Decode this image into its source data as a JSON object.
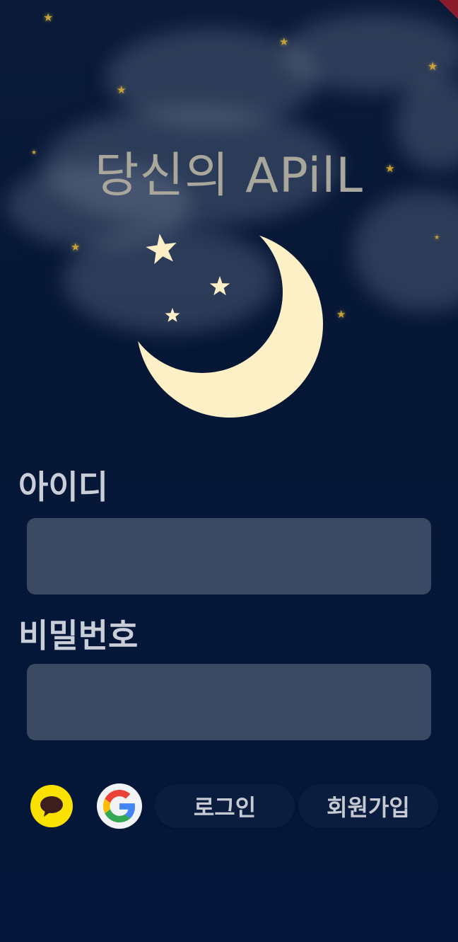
{
  "app": {
    "title": "당신의 APilL"
  },
  "form": {
    "id_label": "아이디",
    "id_value": "",
    "password_label": "비밀번호",
    "password_value": ""
  },
  "actions": {
    "kakao_icon": "kakao-talk-bubble-icon",
    "google_icon": "google-g-icon",
    "login_label": "로그인",
    "signup_label": "회원가입"
  },
  "colors": {
    "background": "#061736",
    "moon": "#fdf0c7",
    "field_background": "#3b4a62",
    "kakao_yellow": "#fae100",
    "star_gold": "#c9a233"
  }
}
